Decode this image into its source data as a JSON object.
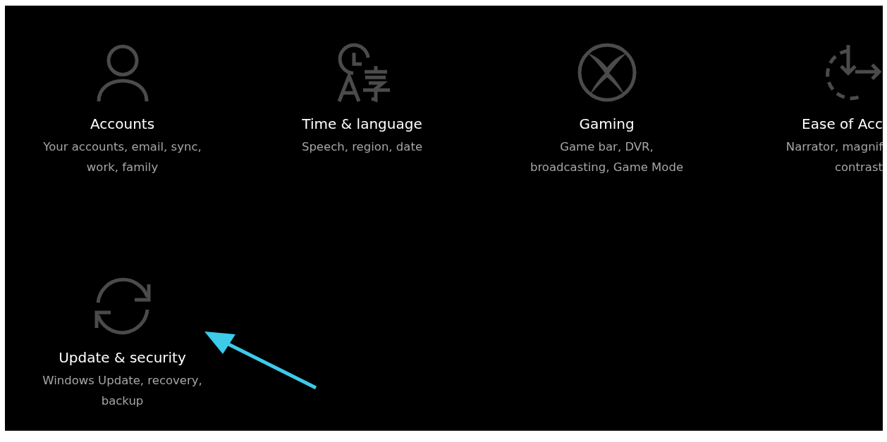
{
  "settings_tiles": [
    {
      "kind": "accounts",
      "title": "Accounts",
      "description": [
        "Your accounts, email, sync,",
        "work, family"
      ],
      "cut_off": false
    },
    {
      "kind": "time-language",
      "title": "Time & language",
      "description": [
        "Speech, region, date"
      ],
      "cut_off": false
    },
    {
      "kind": "gaming",
      "title": "Gaming",
      "description": [
        "Game bar, DVR,",
        "broadcasting, Game Mode"
      ],
      "cut_off": false
    },
    {
      "kind": "ease-of-access",
      "title": "Ease of Acc",
      "description": [
        "Narrator, magnif",
        "contrast"
      ],
      "cut_off": true
    },
    {
      "kind": "update-security",
      "title": "Update & security",
      "description": [
        "Windows Update, recovery,",
        "backup"
      ],
      "cut_off": false
    }
  ],
  "annotation_arrow": {
    "color": "#3ccbe8"
  }
}
